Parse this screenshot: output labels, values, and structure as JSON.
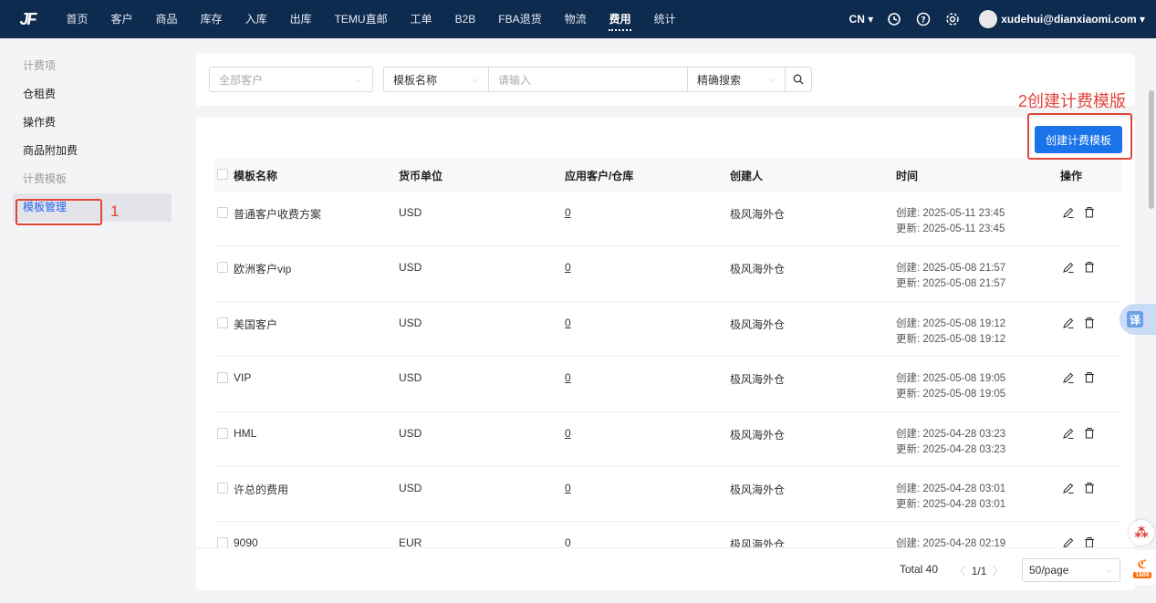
{
  "topnav": {
    "logo": "JF",
    "items": [
      "首页",
      "客户",
      "商品",
      "库存",
      "入库",
      "出库",
      "TEMU直邮",
      "工单",
      "B2B",
      "FBA退货",
      "物流",
      "费用",
      "统计"
    ],
    "active_index": 11,
    "language": "CN",
    "user_email": "xudehui@dianxiaomi.com"
  },
  "sidebar": {
    "group1": "计费项",
    "items1": [
      "仓租费",
      "操作费",
      "商品附加费"
    ],
    "group2": "计费模板",
    "items2": [
      "模板管理"
    ]
  },
  "annotations": {
    "label1": "1",
    "label2": "2创建计费模版"
  },
  "filter": {
    "customer_placeholder": "全部客户",
    "field_select": "模板名称",
    "input_placeholder": "请输入",
    "match_select": "精确搜索"
  },
  "table": {
    "create_button": "创建计费模板",
    "headers": [
      "模板名称",
      "货币单位",
      "应用客户/仓库",
      "创建人",
      "时间",
      "操作"
    ],
    "created_prefix": "创建:",
    "updated_prefix": "更新:",
    "rows": [
      {
        "name": "普通客户收费方案",
        "currency": "USD",
        "applied": "0",
        "creator": "极风海外仓",
        "created": "2025-05-11 23:45",
        "updated": "2025-05-11 23:45"
      },
      {
        "name": "欧洲客户vip",
        "currency": "USD",
        "applied": "0",
        "creator": "极风海外仓",
        "created": "2025-05-08 21:57",
        "updated": "2025-05-08 21:57"
      },
      {
        "name": "美国客户",
        "currency": "USD",
        "applied": "0",
        "creator": "极风海外仓",
        "created": "2025-05-08 19:12",
        "updated": "2025-05-08 19:12"
      },
      {
        "name": "VIP",
        "currency": "USD",
        "applied": "0",
        "creator": "极风海外仓",
        "created": "2025-05-08 19:05",
        "updated": "2025-05-08 19:05"
      },
      {
        "name": "HML",
        "currency": "USD",
        "applied": "0",
        "creator": "极风海外仓",
        "created": "2025-04-28 03:23",
        "updated": "2025-04-28 03:23"
      },
      {
        "name": "许总的费用",
        "currency": "USD",
        "applied": "0",
        "creator": "极风海外仓",
        "created": "2025-04-28 03:01",
        "updated": "2025-04-28 03:01"
      },
      {
        "name": "9090",
        "currency": "EUR",
        "applied": "0",
        "creator": "极风海外仓",
        "created": "2025-04-28 02:19",
        "updated": ""
      }
    ]
  },
  "pagination": {
    "total": "Total 40",
    "page": "1/1",
    "page_size": "50/page"
  },
  "floating": {
    "translate": "译",
    "badge": "1688"
  },
  "colors": {
    "nav_bg": "#0d2a4f",
    "primary": "#1a73e8",
    "annotation": "#e0453a"
  }
}
